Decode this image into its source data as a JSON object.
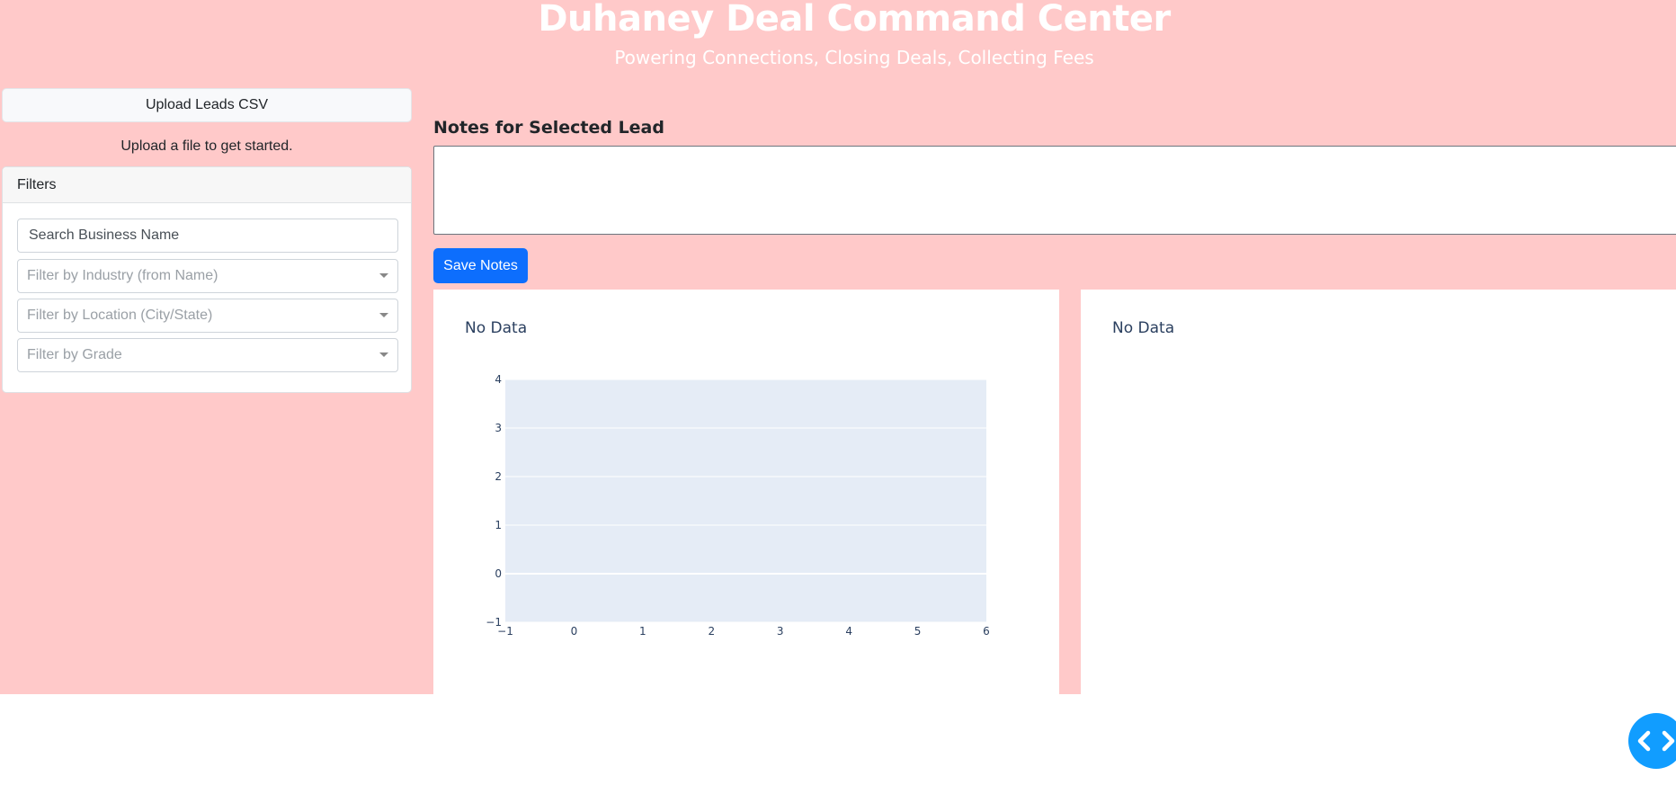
{
  "header": {
    "title": "Duhaney Deal Command Center",
    "subtitle": "Powering Connections, Closing Deals, Collecting Fees"
  },
  "sidebar": {
    "upload_label": "Upload Leads CSV",
    "upload_status": "Upload a file to get started.",
    "filters": {
      "title": "Filters",
      "search_placeholder": "Search Business Name",
      "industry_placeholder": "Filter by Industry (from Name)",
      "location_placeholder": "Filter by Location (City/State)",
      "grade_placeholder": "Filter by Grade"
    }
  },
  "notes": {
    "label": "Notes for Selected Lead",
    "value": "",
    "save_label": "Save Notes"
  },
  "charts": {
    "left_title": "No Data",
    "right_title": "No Data"
  },
  "colors": {
    "page_bg": "#ffc9c9",
    "primary": "#0d6efd",
    "plot_bg": "#e5ecf6",
    "fab": "#119dff"
  },
  "chart_data": [
    {
      "type": "scatter",
      "title": "No Data",
      "x": [],
      "y": [],
      "xlim": [
        -1,
        6
      ],
      "ylim": [
        -1,
        4
      ],
      "xticks": [
        "−1",
        "0",
        "1",
        "2",
        "3",
        "4",
        "5",
        "6"
      ],
      "yticks": [
        "−1",
        "0",
        "1",
        "2",
        "3",
        "4"
      ],
      "grid": true
    },
    {
      "type": "pie",
      "title": "No Data",
      "values": []
    }
  ]
}
